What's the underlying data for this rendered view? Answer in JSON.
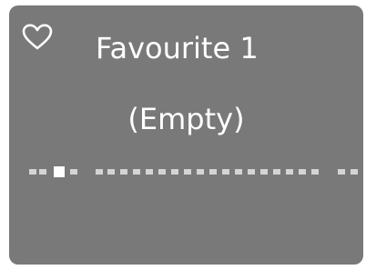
{
  "favourite": {
    "title": "Favourite 1",
    "status": "(Empty)",
    "icon": "heart-outline-icon",
    "selected": false
  },
  "pager": {
    "total_slots": 24,
    "current_index": 2
  },
  "colors": {
    "panel": "#797979",
    "text": "#ffffff",
    "dot": "#d4d4d4",
    "dot_current": "#ffffff"
  }
}
